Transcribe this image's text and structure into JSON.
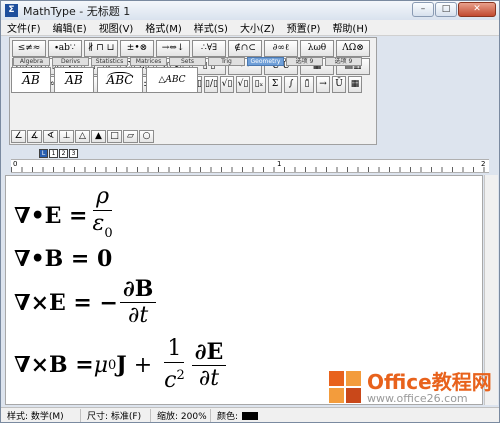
{
  "window": {
    "title": "MathType - 无标题 1",
    "app_icon": "Σ"
  },
  "menu": [
    "文件(F)",
    "编辑(E)",
    "视图(V)",
    "格式(M)",
    "样式(S)",
    "大小(Z)",
    "预置(P)",
    "帮助(H)"
  ],
  "toolbar": {
    "row1": [
      "≤≠≈",
      "∙ab∵",
      "∦ ⊓ ⊔",
      "±•⊗",
      "→⇔↓",
      "∴∀∃",
      "∉∩⊂",
      "∂∞ℓ",
      "λωθ",
      "ΛΩ⊗"
    ],
    "row2": [
      "(▯) [▯]",
      "▯/▯ √▯",
      "▯ˣ ▯ₓ",
      "Σ▯ Σ▯",
      "∫▯ ∮▯",
      "▯ ▯̄",
      "→ ←",
      "Ū Ů",
      "▦",
      "▤▥"
    ],
    "row3": [
      "π",
      "θ",
      "∞",
      "∈",
      "→",
      "∂",
      "≤",
      "≠",
      "±",
      "(▯)",
      "[▯]",
      "▯/▯",
      "▯/▯",
      "√▯",
      "√▯",
      "▯ₓ",
      "Σ",
      "∫",
      "▯̄",
      "→",
      "Ū",
      "▦"
    ],
    "tabs": [
      "Algebra",
      "Derivs",
      "Statistics",
      "Matrices",
      "Sets",
      "Trig",
      "Geometry",
      "选项 9",
      "选项 9"
    ],
    "active_tab": "Geometry",
    "templates": [
      "AB",
      "AB",
      "ABC",
      "△ABC"
    ],
    "shapes": [
      "∠",
      "∡",
      "∢",
      "⊥",
      "△",
      "▲",
      "□",
      "▱",
      "○"
    ]
  },
  "ruler": {
    "buttons": [
      "L",
      "1",
      "2",
      "3"
    ],
    "marks": [
      "0",
      "1",
      "2"
    ]
  },
  "equations": {
    "eq1": {
      "lhs": "∇•E = ",
      "num": "ρ",
      "den": "ε",
      "den_sub": "0"
    },
    "eq2": {
      "text": "∇•B = 0"
    },
    "eq3": {
      "lhs": "∇×E = −",
      "num": "∂B",
      "den": "∂t"
    },
    "eq4": {
      "lhs": "∇×B = ",
      "mu": "μ",
      "mu_sub": "0",
      "J": "J",
      "plus": " + ",
      "num1": "1",
      "den1": "c",
      "den1_sup": "2",
      "num2": "∂E",
      "den2": "∂t"
    }
  },
  "status": {
    "style": "样式: 数学(M)",
    "size": "尺寸: 标准(F)",
    "zoom": "缩放: 200%",
    "color": "颜色:"
  },
  "watermark": {
    "title": "Office教程网",
    "url": "www.office26.com"
  },
  "colors": {
    "active_tab": "#6f9fd8",
    "watermark": "#e8621c",
    "title_close": "#c24a30"
  }
}
